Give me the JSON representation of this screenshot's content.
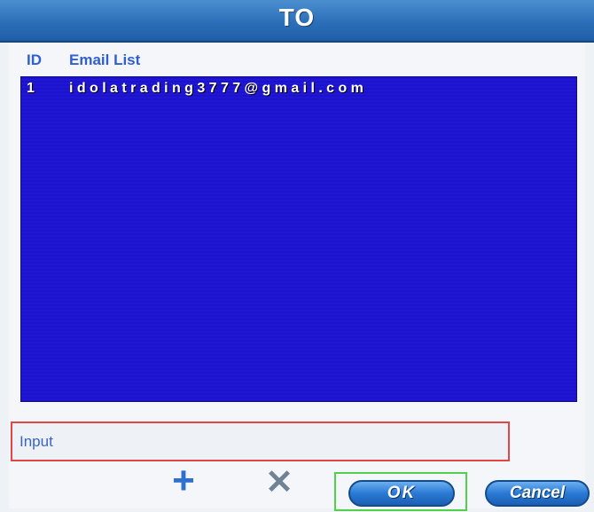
{
  "dialog": {
    "title": "TO"
  },
  "list": {
    "headers": {
      "id": "ID",
      "email": "Email List"
    },
    "rows": [
      {
        "id": "1",
        "email": "idolatrading3777@gmail.com"
      }
    ]
  },
  "input": {
    "label": "Input",
    "value": ""
  },
  "actions": {
    "add_symbol": "+",
    "delete_symbol": "✕",
    "ok_label": "OK",
    "cancel_label": "Cancel"
  },
  "colors": {
    "list_background": "#1c12c9",
    "header_text": "#2f5fd0",
    "input_highlight": "#e44545",
    "ok_highlight": "#4fd24a"
  }
}
